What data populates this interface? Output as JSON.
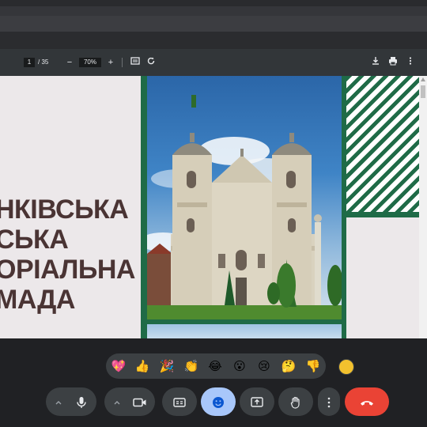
{
  "pdf_toolbar": {
    "page_current": "1",
    "page_total": "/ 35",
    "zoom": "70%",
    "zoom_out": "−",
    "zoom_in": "+"
  },
  "slide": {
    "title_lines": [
      "НКІВСЬКА",
      "СЬКА",
      "ОРІАЛЬНА",
      "МАДА"
    ]
  },
  "reactions": {
    "emojis": [
      "💖",
      "👍",
      "🎉",
      "👏",
      "😂",
      "😮",
      "😢",
      "🤔",
      "👎"
    ]
  },
  "colors": {
    "green": "#1f6b47",
    "end_call": "#ea4335",
    "reaction_active": "#a8c7fa"
  },
  "icons": {
    "download": "download-icon",
    "print": "print-icon",
    "more": "more-vert-icon",
    "fit": "fit-page-icon",
    "rotate": "rotate-icon",
    "mic": "mic-icon",
    "camera": "camera-icon",
    "captions": "captions-icon",
    "emoji": "emoji-icon",
    "present": "present-icon",
    "hand": "raise-hand-icon",
    "end": "end-call-icon"
  }
}
